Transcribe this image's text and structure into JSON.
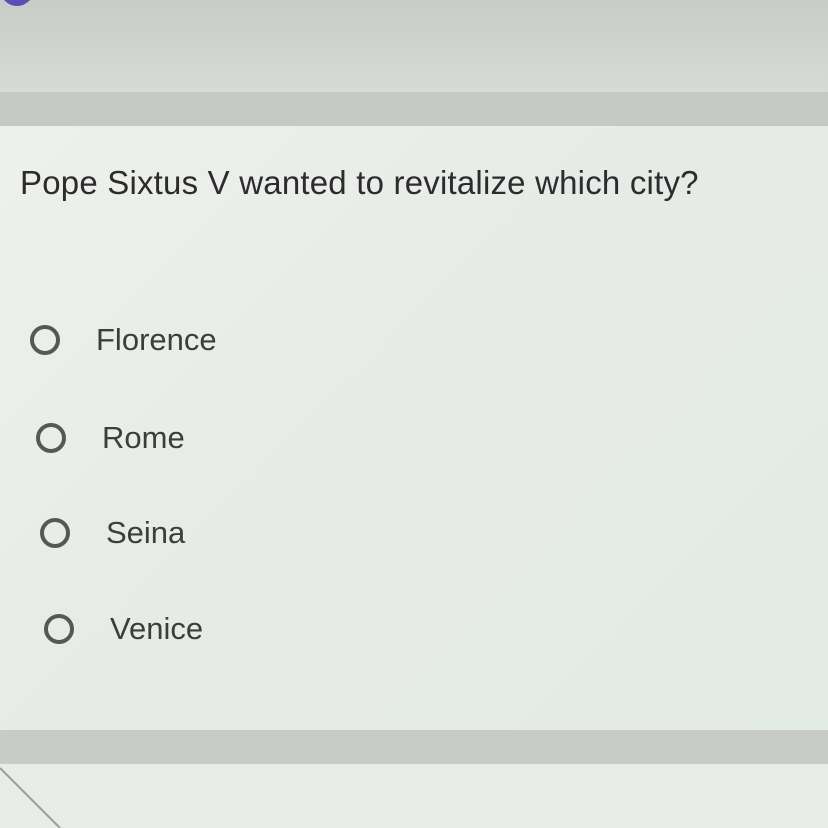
{
  "question": {
    "text": "Pope Sixtus V wanted to revitalize which city?"
  },
  "options": [
    {
      "label": "Florence",
      "selected": false
    },
    {
      "label": "Rome",
      "selected": false
    },
    {
      "label": "Seina",
      "selected": false
    },
    {
      "label": "Venice",
      "selected": false
    }
  ],
  "colors": {
    "background": "#dfe3de",
    "card": "#eef0ec",
    "text": "#2b2c2b",
    "radio_border": "#565856",
    "accent": "#5b4fb6"
  }
}
